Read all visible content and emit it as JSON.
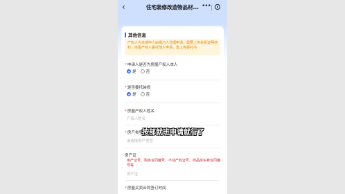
{
  "header": {
    "back_icon": "chevron-left-icon",
    "title": "住宅装修改造物品材...",
    "more_label": "•••"
  },
  "form": {
    "section_title": "其他信息",
    "notice": "产权人为本或申人由提乃人代理申请，需要上传关系证明材料，房屋产权人委托他人申请，需上传委托书",
    "q_owner": {
      "label": "申请人是否为房屋产权人本人",
      "yes": "是",
      "no": "否",
      "selected": "是"
    },
    "q_entrust": {
      "label": "是否委托装修",
      "yes": "是",
      "no": "否",
      "selected": "是"
    },
    "owner_name": {
      "label": "房屋产权人姓名",
      "placeholder": "产权人姓名"
    },
    "property_type": {
      "label": "房产类型",
      "placeholder": "请选择房产类型"
    },
    "property_no": {
      "label": "房产证",
      "hint": "房产证号、购房合同编号、不动产权证号、商品房买卖合同编号等",
      "placeholder": "房产证"
    },
    "sign_time": {
      "label": "房屋买卖合同签订时间"
    }
  },
  "overlay": {
    "caption": "按部就班申请就行了"
  },
  "colors": {
    "accent": "#2f6bff",
    "notice_bg": "#fff4dc",
    "notice_text": "#e08a00",
    "hint_text": "#d12b2b",
    "required_star": "#e33333"
  }
}
